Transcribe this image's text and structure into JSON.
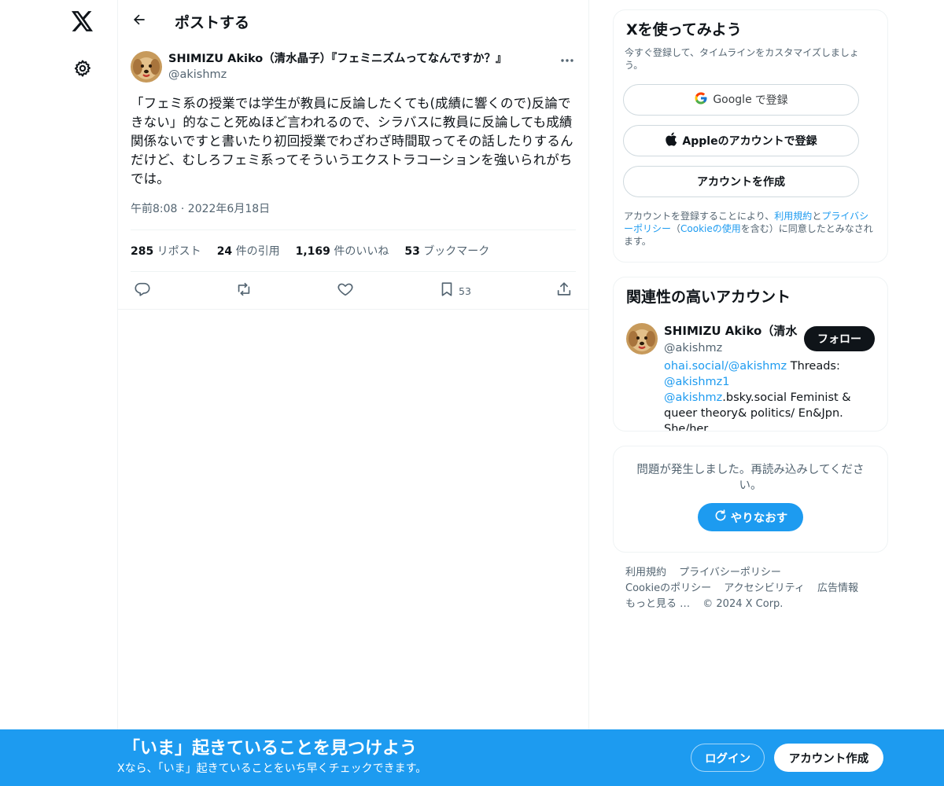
{
  "nav": {
    "logo_icon": "x-logo-icon",
    "settings_icon": "gear-icon"
  },
  "header": {
    "title": "ポストする",
    "back_icon": "arrow-left-icon"
  },
  "post": {
    "author_name": "SHIMIZU Akiko（清水晶子）『フェミニズムってなんですか？』",
    "author_handle": "@akishmz",
    "text": "「フェミ系の授業では学生が教員に反論したくても(成績に響くので)反論できない」的なこと死ぬほど言われるので、シラバスに教員に反論しても成績関係ないですと書いたり初回授業でわざわざ時間取ってその話したりするんだけど、むしろフェミ系ってそういうエクストラコーションを強いられがちでは。",
    "time": "午前8:08 · 2022年6月18日",
    "stats": [
      {
        "value": "285",
        "label": "リポスト"
      },
      {
        "value": "24",
        "label": "件の引用"
      },
      {
        "value": "1,169",
        "label": "件のいいね"
      },
      {
        "value": "53",
        "label": "ブックマーク"
      }
    ],
    "actions": {
      "bookmark_count": "53"
    }
  },
  "signup_card": {
    "title": "Xを使ってみよう",
    "subtitle": "今すぐ登録して、タイムラインをカスタマイズしましょう。",
    "google_brand": "Google",
    "google_suffix": "で登録",
    "apple_label": "Appleのアカウントで登録",
    "create_label": "アカウントを作成",
    "legal_prefix": "アカウントを登録することにより、",
    "legal_terms": "利用規約",
    "legal_and": "と",
    "legal_privacy": "プライバシーポリシー",
    "legal_paren_open": "（",
    "legal_cookie": "Cookieの使用",
    "legal_suffix": "を含む）に同意したとみなされます。"
  },
  "related": {
    "title": "関連性の高いアカウント",
    "name": "SHIMIZU Akiko（清水晶子）『フェミニズムってなんですか？』",
    "handle": "@akishmz",
    "follow_label": "フォロー",
    "bio_link1": "ohai.social/@akishmz",
    "bio_text1": " Threads: ",
    "bio_link2": "@akishmz1",
    "bio_space": " ",
    "bio_link3": "@akishmz",
    "bio_text2": ".bsky.social Feminist & queer theory& politics/ En&Jpn. She/her."
  },
  "error_card": {
    "message": "問題が発生しました。再読み込みしてください。",
    "retry_label": "やりなおす"
  },
  "footer": {
    "links": [
      "利用規約",
      "プライバシーポリシー",
      "Cookieのポリシー",
      "アクセシビリティ",
      "広告情報",
      "もっと見る …"
    ],
    "copyright": "© 2024 X Corp."
  },
  "bottom_bar": {
    "title": "「いま」起きていることを見つけよう",
    "subtitle": "Xなら、「いま」起きていることをいち早くチェックできます。",
    "login_label": "ログイン",
    "signup_label": "アカウント作成"
  },
  "colors": {
    "accent": "#1d9bf0",
    "text": "#0f1419",
    "muted": "#536471",
    "border": "#eff3f4"
  }
}
